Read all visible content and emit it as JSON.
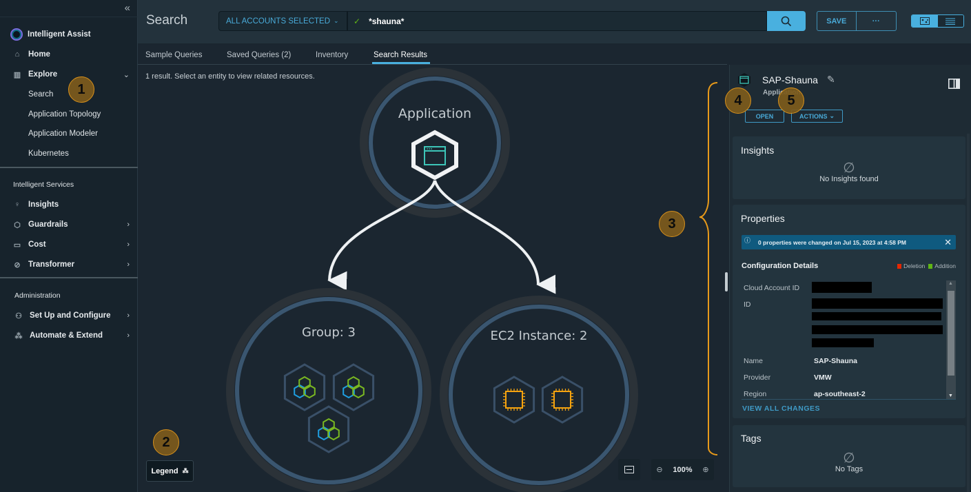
{
  "sidebar": {
    "collapse_icon": "double-chevron-left-icon",
    "brand": "Intelligent Assist",
    "home": "Home",
    "explore": "Explore",
    "explore_sub": [
      "Search",
      "Application Topology",
      "Application Modeler",
      "Kubernetes"
    ],
    "section_services": "Intelligent Services",
    "insights": "Insights",
    "guardrails": "Guardrails",
    "cost": "Cost",
    "transformer": "Transformer",
    "section_admin": "Administration",
    "setup": "Set Up and Configure",
    "automate": "Automate & Extend"
  },
  "header": {
    "title": "Search",
    "accounts": "ALL ACCOUNTS SELECTED",
    "query": "*shauna*",
    "save": "SAVE",
    "more": "···"
  },
  "tabs": [
    "Sample Queries",
    "Saved Queries (2)",
    "Inventory",
    "Search Results"
  ],
  "active_tab": "Search Results",
  "canvas": {
    "result_text": "1 result. Select an entity to view related resources.",
    "nodes": {
      "application": "Application",
      "group": "Group: 3",
      "ec2": "EC2 Instance: 2"
    },
    "legend": "Legend",
    "zoom": "100%"
  },
  "panel": {
    "entity_name": "SAP-Shauna",
    "entity_type": "Application",
    "open": "OPEN",
    "actions": "ACTIONS",
    "insights_title": "Insights",
    "insights_empty": "No Insights found",
    "properties_title": "Properties",
    "alert": "0 properties were changed on Jul 15, 2023 at 4:58 PM",
    "config_title": "Configuration Details",
    "legend_deletion": "Deletion",
    "legend_addition": "Addition",
    "deletion_color": "#e62700",
    "addition_color": "#60b515",
    "props": {
      "cloud_account_label": "Cloud Account ID",
      "id_label": "ID",
      "name_label": "Name",
      "name_value": "SAP-Shauna",
      "provider_label": "Provider",
      "provider_value": "VMW",
      "region_label": "Region",
      "region_value": "ap-southeast-2"
    },
    "view_all": "VIEW ALL CHANGES",
    "tags_title": "Tags",
    "tags_empty": "No Tags"
  },
  "annotations": [
    "1",
    "2",
    "3",
    "4",
    "5"
  ]
}
